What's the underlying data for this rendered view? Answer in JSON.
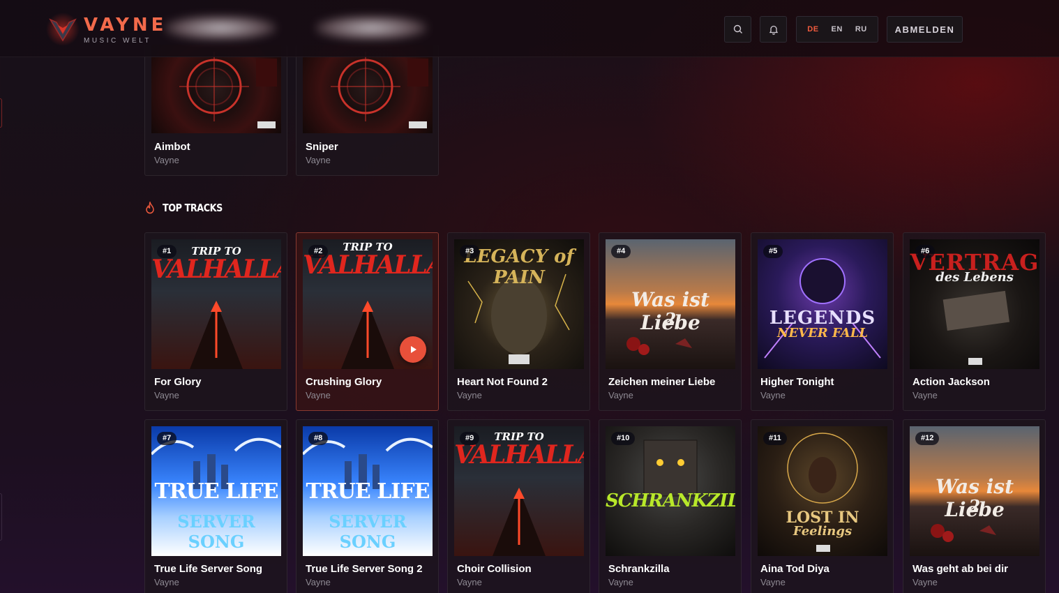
{
  "brand": {
    "name": "VAYNE",
    "tagline": "MUSIC WELT"
  },
  "header": {
    "languages": [
      {
        "code": "DE",
        "active": true
      },
      {
        "code": "EN",
        "active": false
      },
      {
        "code": "RU",
        "active": false
      }
    ],
    "logout_label": "ABMELDEN"
  },
  "colors": {
    "accent": "#ef5a3d",
    "muted": "#8e8a93"
  },
  "top_cards": [
    {
      "title": "Aimbot",
      "artist": "Vayne"
    },
    {
      "title": "Sniper",
      "artist": "Vayne"
    }
  ],
  "top_tracks": {
    "title": "TOP TRACKS",
    "icon": "flame-icon",
    "tracks": [
      {
        "rank": "#1",
        "title": "For Glory",
        "artist": "Vayne",
        "cover": "TRIP TO VALHALLA"
      },
      {
        "rank": "#2",
        "title": "Crushing Glory",
        "artist": "Vayne",
        "cover": "TRIP TO VALHALLA"
      },
      {
        "rank": "#3",
        "title": "Heart Not Found 2",
        "artist": "Vayne",
        "cover": "LEGACY OF PAIN"
      },
      {
        "rank": "#4",
        "title": "Zeichen meiner Liebe",
        "artist": "Vayne",
        "cover": "Was ist Liebe 2"
      },
      {
        "rank": "#5",
        "title": "Higher Tonight",
        "artist": "Vayne",
        "cover": "LEGENDS NEVER FALL"
      },
      {
        "rank": "#6",
        "title": "Action Jackson",
        "artist": "Vayne",
        "cover": "VERTRAG des Lebens"
      },
      {
        "rank": "#7",
        "title": "True Life Server Song",
        "artist": "Vayne",
        "cover": "TRUE LIFE SERVER SONG"
      },
      {
        "rank": "#8",
        "title": "True Life Server Song 2",
        "artist": "Vayne",
        "cover": "TRUE LIFE SERVER SONG"
      },
      {
        "rank": "#9",
        "title": "Choir Collision",
        "artist": "Vayne",
        "cover": "TRIP TO VALHALLA"
      },
      {
        "rank": "#10",
        "title": "Schrankzilla",
        "artist": "Vayne",
        "cover": "SCHRANKZILLA"
      },
      {
        "rank": "#11",
        "title": "Aina Tod Diya",
        "artist": "Vayne",
        "cover": "LOST IN Feelings"
      },
      {
        "rank": "#12",
        "title": "Was geht ab bei dir",
        "artist": "Vayne",
        "cover": "Was ist Liebe 2"
      }
    ]
  }
}
